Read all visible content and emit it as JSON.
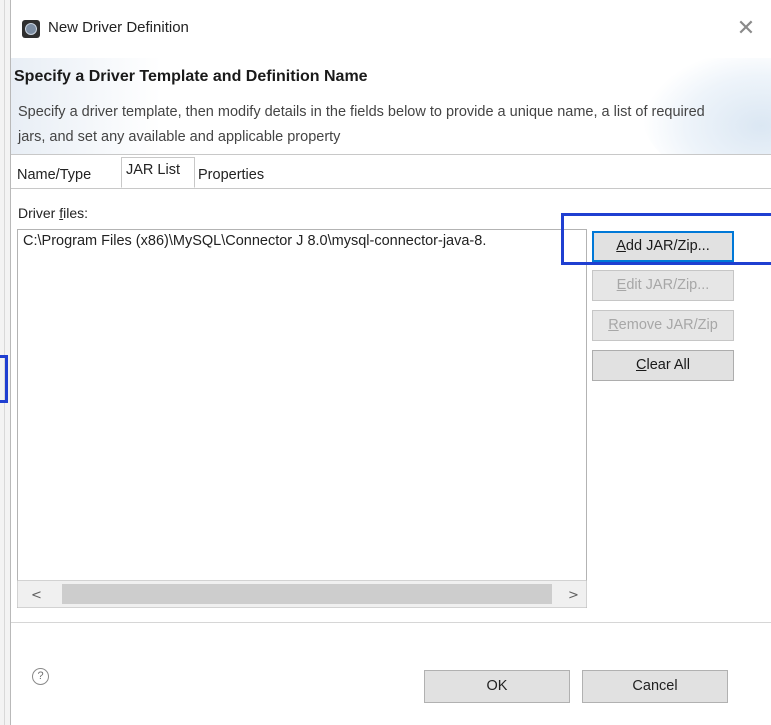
{
  "window": {
    "title": "New Driver Definition",
    "close_symbol": "✕"
  },
  "header": {
    "title": "Specify a Driver Template and Definition Name",
    "description": "Specify a driver template, then modify details in the fields below to provide a unique name, a list of required jars, and set any available and applicable property"
  },
  "tabs": [
    {
      "label": "Name/Type",
      "active": false
    },
    {
      "label": "JAR List",
      "active": true
    },
    {
      "label": "Properties",
      "active": false
    }
  ],
  "driver_files": {
    "label_prefix": "Driver ",
    "label_mnemonic": "f",
    "label_rest": "iles:",
    "items": [
      "C:\\Program Files (x86)\\MySQL\\Connector J 8.0\\mysql-connector-java-8."
    ]
  },
  "side_buttons": {
    "add_mnemonic": "A",
    "add_rest": "dd JAR/Zip...",
    "edit_mnemonic": "E",
    "edit_rest": "dit JAR/Zip...",
    "remove_mnemonic": "R",
    "remove_rest": "emove JAR/Zip",
    "clear_mnemonic": "C",
    "clear_rest": "lear All"
  },
  "scrollbar": {
    "left_arrow": "<",
    "right_arrow": ">"
  },
  "footer": {
    "help_symbol": "?",
    "ok_label": "OK",
    "cancel_label": "Cancel"
  },
  "colors": {
    "annotation_blue": "#1f3fd1",
    "button_face": "#e1e1e1",
    "default_button_border": "#0078d7"
  }
}
